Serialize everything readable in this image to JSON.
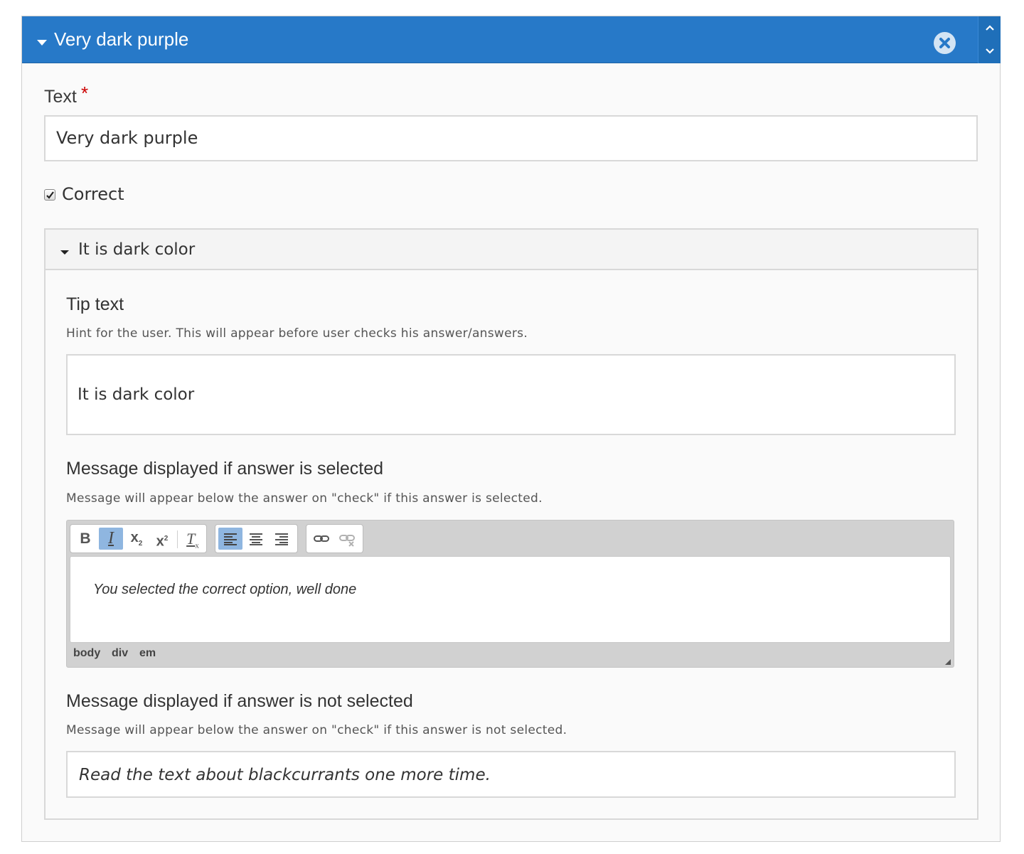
{
  "colors": {
    "header_bg": "#2779c8",
    "required": "#cc0000",
    "active_tool": "#8fb6e0"
  },
  "panel": {
    "title": "Very dark purple",
    "remove_icon": "close-circle-icon",
    "move_up_icon": "chevron-up-icon",
    "move_down_icon": "chevron-down-icon"
  },
  "text_field": {
    "label": "Text",
    "required_mark": "*",
    "value": "Very dark purple"
  },
  "correct": {
    "label": "Correct",
    "checked": true
  },
  "tips": {
    "group_title": "It is dark color",
    "tip_text": {
      "label": "Tip text",
      "description": "Hint for the user. This will appear before user checks his answer/answers.",
      "value": "It is dark color"
    },
    "selected_message": {
      "label": "Message displayed if answer is selected",
      "description": "Message will appear below the answer on \"check\" if this answer is selected.",
      "value": "You selected the correct option, well done",
      "toolbar": {
        "bold": "B",
        "italic": "I",
        "subscript": "x",
        "superscript": "x",
        "remove_format": "T",
        "active": [
          "italic",
          "align-left"
        ]
      },
      "path": [
        "body",
        "div",
        "em"
      ]
    },
    "not_selected_message": {
      "label": "Message displayed if answer is not selected",
      "description": "Message will appear below the answer on \"check\" if this answer is not selected.",
      "value": "Read the text about blackcurrants one more time."
    }
  }
}
